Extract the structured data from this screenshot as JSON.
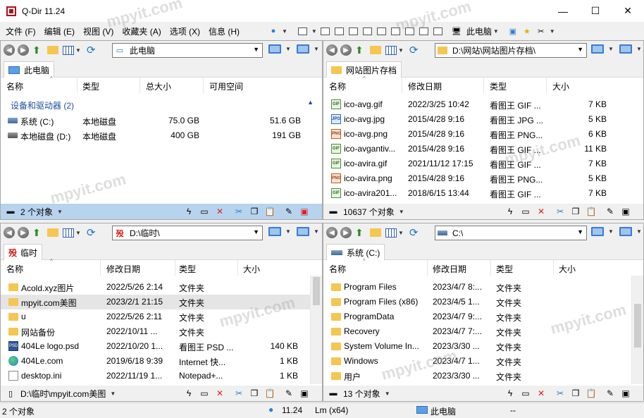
{
  "app": {
    "title": "Q-Dir 11.24",
    "min": "—",
    "max": "☐",
    "close": "✕"
  },
  "menu": {
    "items": [
      "文件 (F)",
      "编辑 (E)",
      "视图 (V)",
      "收藏夹 (A)",
      "选项 (X)",
      "信息 (H)"
    ],
    "computer_label": "此电脑"
  },
  "panes": {
    "tl": {
      "address": "此电脑",
      "tab": "此电脑",
      "headers": [
        "名称",
        "类型",
        "总大小",
        "可用空间"
      ],
      "group": "设备和驱动器 (2)",
      "rows": [
        {
          "name": "系统 (C:)",
          "type": "本地磁盘",
          "total": "75.0 GB",
          "free": "51.6 GB",
          "icon": "drive-c-icon"
        },
        {
          "name": "本地磁盘 (D:)",
          "type": "本地磁盘",
          "total": "400 GB",
          "free": "191 GB",
          "icon": "drive-icon"
        }
      ],
      "status": "2 个对象"
    },
    "tr": {
      "address": "D:\\网站\\网站图片存档\\",
      "tab": "网站图片存档",
      "headers": [
        "名称",
        "修改日期",
        "类型",
        "大小"
      ],
      "rows": [
        {
          "name": "ico-avg.gif",
          "date": "2022/3/25 10:42",
          "type": "看图王 GIF ...",
          "size": "7 KB",
          "icon": "gif"
        },
        {
          "name": "ico-avg.jpg",
          "date": "2015/4/28 9:16",
          "type": "看图王 JPG ...",
          "size": "5 KB",
          "icon": "jpg"
        },
        {
          "name": "ico-avg.png",
          "date": "2015/4/28 9:16",
          "type": "看图王 PNG...",
          "size": "6 KB",
          "icon": "png"
        },
        {
          "name": "ico-avgantiv...",
          "date": "2015/4/28 9:16",
          "type": "看图王 GIF ...",
          "size": "11 KB",
          "icon": "gif"
        },
        {
          "name": "ico-avira.gif",
          "date": "2021/11/12 17:15",
          "type": "看图王 GIF ...",
          "size": "7 KB",
          "icon": "gif"
        },
        {
          "name": "ico-avira.png",
          "date": "2015/4/28 9:16",
          "type": "看图王 PNG...",
          "size": "5 KB",
          "icon": "png"
        },
        {
          "name": "ico-avira201...",
          "date": "2018/6/15 13:44",
          "type": "看图王 GIF ...",
          "size": "7 KB",
          "icon": "gif"
        }
      ],
      "status": "10637 个对象"
    },
    "bl": {
      "address": "D:\\临时\\",
      "tab": "临时",
      "headers": [
        "名称",
        "修改日期",
        "类型",
        "大小"
      ],
      "rows": [
        {
          "name": "Acold.xyz图片",
          "date": "2022/5/26 2:14",
          "type": "文件夹",
          "size": "",
          "icon": "folder"
        },
        {
          "name": "mpyit.com美图",
          "date": "2023/2/1 21:15",
          "type": "文件夹",
          "size": "",
          "icon": "folder"
        },
        {
          "name": "u",
          "date": "2022/5/26 2:11",
          "type": "文件夹",
          "size": "",
          "icon": "folder"
        },
        {
          "name": "网站备份",
          "date": "2022/10/11 ...",
          "type": "文件夹",
          "size": "",
          "icon": "folder"
        },
        {
          "name": "404Le logo.psd",
          "date": "2022/10/20 1...",
          "type": "看图王 PSD ...",
          "size": "140 KB",
          "icon": "psd"
        },
        {
          "name": "404Le.com",
          "date": "2019/6/18 9:39",
          "type": "Internet 快...",
          "size": "1 KB",
          "icon": "edge"
        },
        {
          "name": "desktop.ini",
          "date": "2022/11/19 1...",
          "type": "Notepad+...",
          "size": "1 KB",
          "icon": "ini"
        }
      ],
      "status": "D:\\临时\\mpyit.com美图"
    },
    "br": {
      "address": "C:\\",
      "tab": "系统 (C:)",
      "headers": [
        "名称",
        "修改日期",
        "类型",
        "大小"
      ],
      "rows": [
        {
          "name": "Program Files",
          "date": "2023/4/7 8:...",
          "type": "文件夹",
          "size": "",
          "icon": "folder"
        },
        {
          "name": "Program Files (x86)",
          "date": "2023/4/5 1...",
          "type": "文件夹",
          "size": "",
          "icon": "folder"
        },
        {
          "name": "ProgramData",
          "date": "2023/4/7 9:...",
          "type": "文件夹",
          "size": "",
          "icon": "folder"
        },
        {
          "name": "Recovery",
          "date": "2023/4/7 7:...",
          "type": "文件夹",
          "size": "",
          "icon": "folder"
        },
        {
          "name": "System Volume In...",
          "date": "2023/3/30 ...",
          "type": "文件夹",
          "size": "",
          "icon": "folder"
        },
        {
          "name": "Windows",
          "date": "2023/4/7 1...",
          "type": "文件夹",
          "size": "",
          "icon": "folder"
        },
        {
          "name": "用户",
          "date": "2023/3/30 ...",
          "type": "文件夹",
          "size": "",
          "icon": "folder"
        }
      ],
      "status": "13 个对象"
    }
  },
  "bottom": {
    "count": "2 个对象",
    "version": "11.24",
    "arch": "Lm (x64)",
    "location": "此电脑",
    "dash": "--"
  },
  "watermark": "mpyit.com",
  "colors": {
    "status_active": "#b8d3ee",
    "group_text": "#1e4f9c",
    "delete_red": "#e0201c"
  }
}
